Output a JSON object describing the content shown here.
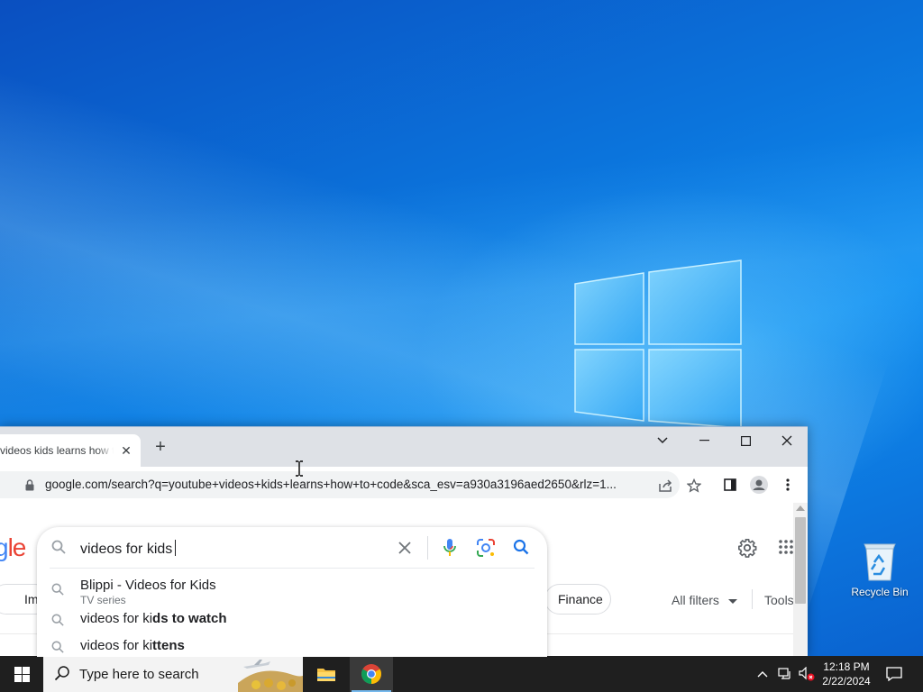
{
  "desktop": {
    "recycle_bin_label": "Recycle Bin"
  },
  "browser": {
    "tab_title": "videos kids learns how to code",
    "tab_close": "✕",
    "new_tab": "+",
    "url": "google.com/search?q=youtube+videos+kids+learns+how+to+code&sca_esv=a930a3196aed2650&rlz=1...",
    "logo_visible": "gle"
  },
  "search": {
    "query": "videos for kids",
    "suggestions": [
      {
        "prefix": "Blippi - Videos for Kids",
        "bold": "",
        "sub": "TV series"
      },
      {
        "prefix": "videos for ki",
        "bold": "ds to watch",
        "sub": ""
      },
      {
        "prefix": "videos for ki",
        "bold": "ttens",
        "sub": ""
      }
    ]
  },
  "filters": {
    "chip_images": "Im",
    "chip_finance": "Finance",
    "all_filters": "All filters",
    "tools": "Tools"
  },
  "taskbar": {
    "search_placeholder": "Type here to search",
    "time": "12:18 PM",
    "date": "2/22/2024"
  },
  "colors": {
    "accent_blue": "#1a73e8",
    "taskbar": "#1f1f1f",
    "wallpaper": "#0b74dc"
  }
}
